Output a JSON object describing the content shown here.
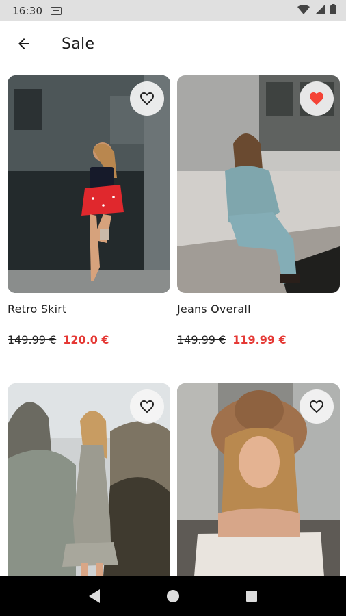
{
  "status_bar": {
    "time": "16:30",
    "icons": [
      "sim-card-icon",
      "wifi-icon",
      "signal-icon",
      "battery-icon"
    ]
  },
  "app_bar": {
    "title": "Sale",
    "back_icon": "arrow-left-icon"
  },
  "products": [
    {
      "name": "Retro Skirt",
      "old_price": "149.99 €",
      "sale_price": "120.0 €",
      "favorite": false
    },
    {
      "name": "Jeans Overall",
      "old_price": "149.99 €",
      "sale_price": "119.99 €",
      "favorite": true
    },
    {
      "name": "",
      "old_price": "",
      "sale_price": "",
      "favorite": false
    },
    {
      "name": "",
      "old_price": "",
      "sale_price": "",
      "favorite": false
    }
  ],
  "colors": {
    "sale_price": "#e53935",
    "favorite_active": "#f44336",
    "status_bar_bg": "#e0e0e0",
    "nav_bar_bg": "#000000"
  },
  "nav_bar": {
    "icons": [
      "back-triangle-icon",
      "home-circle-icon",
      "recents-square-icon"
    ]
  }
}
